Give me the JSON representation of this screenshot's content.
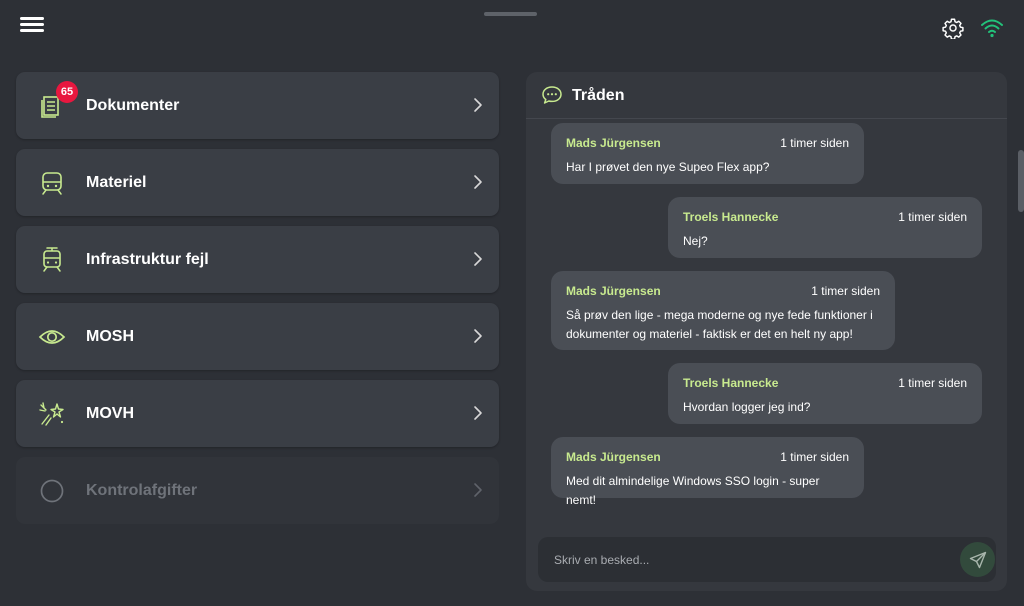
{
  "colors": {
    "background": "#2d3036",
    "card": "#3a3e45",
    "accent_green": "#c8ea8f",
    "wifi_green": "#22c27a",
    "badge_red": "#e8173f",
    "bubble": "#4a4e55"
  },
  "topbar": {
    "menu_icon": "hamburger-icon",
    "settings_icon": "gear-icon",
    "connection_icon": "wifi-icon"
  },
  "menu": {
    "items": [
      {
        "label": "Dokumenter",
        "icon": "documents-icon",
        "badge": "65"
      },
      {
        "label": "Materiel",
        "icon": "train-icon"
      },
      {
        "label": "Infrastruktur fejl",
        "icon": "tram-icon"
      },
      {
        "label": "MOSH",
        "icon": "eye-icon"
      },
      {
        "label": "MOVH",
        "icon": "sparks-icon"
      },
      {
        "label": "Kontrolafgifter",
        "icon": "circle-icon",
        "disabled": true
      }
    ]
  },
  "chat": {
    "title": "Tråden",
    "messages": [
      {
        "author": "Mads Jürgensen",
        "time": "1 timer siden",
        "text": "Har I prøvet den nye Supeo Flex app?",
        "side": "left"
      },
      {
        "author": "Troels Hannecke",
        "time": "1 timer siden",
        "text": "Nej?",
        "side": "right"
      },
      {
        "author": "Mads Jürgensen",
        "time": "1 timer siden",
        "text_lines": [
          "Så prøv den lige - mega moderne og nye fede funktioner i",
          "dokumenter og materiel - faktisk er det en helt ny app!"
        ],
        "side": "left"
      },
      {
        "author": "Troels Hannecke",
        "time": "1 timer siden",
        "text": "Hvordan logger jeg ind?",
        "side": "right"
      },
      {
        "author": "Mads Jürgensen",
        "time": "1 timer siden",
        "text": "Med dit almindelige Windows SSO login - super nemt!",
        "side": "left"
      }
    ],
    "composer": {
      "placeholder": "Skriv en besked..."
    }
  }
}
